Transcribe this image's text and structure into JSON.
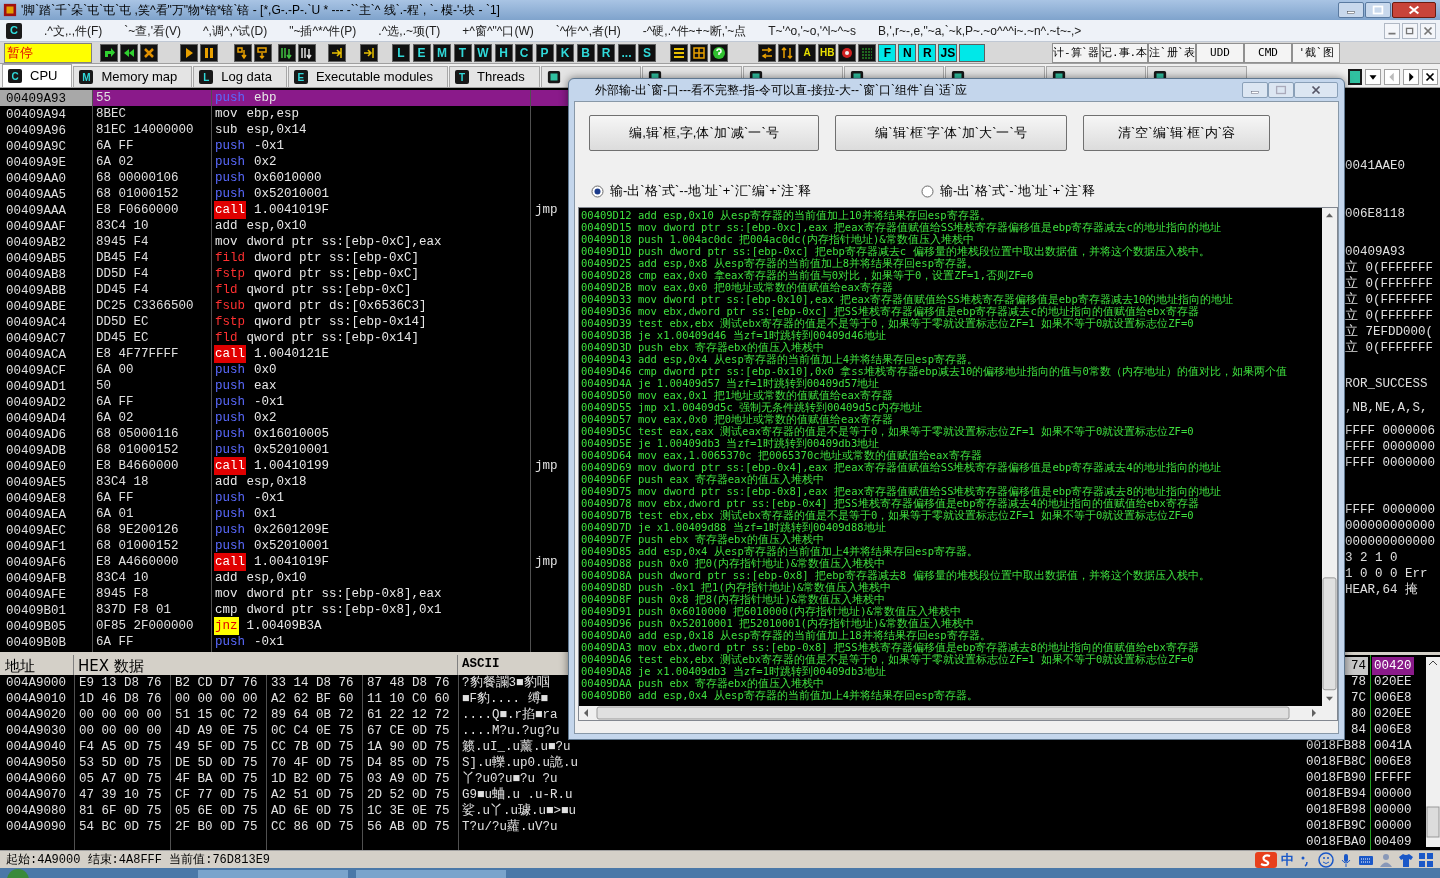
{
  "window": {
    "title": "'脚`踏`千`朵`屯`屯`屯 ,笑^看\"万\"物*锫*锫`锫 - [*,G-.-P-.`U *  ---  -``主`^ 线`.-程`, `- 模-'-块  - `1]"
  },
  "menu": [
    ".^文,.,件(F)",
    "`~查,'看(V)",
    "^,调^,^试(D)",
    "\"~插^*^件(P)",
    ".^选,.~项(T)",
    "+^窗^\"^口(W)",
    "`^作^^,者(H)",
    "-^硬,.^件~+~断,'~点",
    "T~'^o,'~o,'^l~^~s",
    "B,',r~-,e,\"~a,`~k,P~.~o^^^i~.~n^.~t~-,>"
  ],
  "menu_badge": "C",
  "toolbar": {
    "status": "暂停",
    "view_buttons": [
      "L",
      "E",
      "M",
      "T",
      "W",
      "H",
      "C",
      "P",
      "K",
      "B",
      "R",
      "...",
      "S"
    ],
    "plugin_buttons": [
      "A",
      "HB"
    ],
    "script_buttons": [
      "F",
      "N",
      "R",
      "JS"
    ],
    "tools": [
      "计-算`器",
      "记.事.本",
      "注`册`表",
      "UDD",
      "CMD",
      "'截`图"
    ]
  },
  "tabs": [
    {
      "badge": "C",
      "label": "CPU",
      "selected": true
    },
    {
      "badge": "M",
      "label": "Memory map",
      "selected": false
    },
    {
      "badge": "L",
      "label": "Log data",
      "selected": false
    },
    {
      "badge": "E",
      "label": "Executable modules",
      "selected": false
    },
    {
      "badge": "T",
      "label": "Threads",
      "selected": false
    },
    {
      "selected": false
    },
    {
      "selected": false
    },
    {
      "selected": false
    },
    {
      "selected": false
    },
    {
      "selected": false
    },
    {
      "selected": false
    },
    {
      "selected": false
    }
  ],
  "disassembly": [
    {
      "address": "00409A93",
      "hex": "55",
      "op": "push",
      "args": "ebp",
      "kind": "push",
      "selected": true
    },
    {
      "address": "00409A94",
      "hex": "8BEC",
      "op": "mov",
      "args": "ebp,esp",
      "kind": "plain",
      "selected": false
    },
    {
      "address": "00409A96",
      "hex": "81EC 14000000",
      "op": "sub",
      "args": "esp,0x14",
      "kind": "plain",
      "selected": false
    },
    {
      "address": "00409A9C",
      "hex": "6A FF",
      "op": "push",
      "args": "-0x1",
      "kind": "push",
      "selected": false
    },
    {
      "address": "00409A9E",
      "hex": "6A 02",
      "op": "push",
      "args": "0x2",
      "kind": "push",
      "selected": false
    },
    {
      "address": "00409AA0",
      "hex": "68 00000106",
      "op": "push",
      "args": "0x6010000",
      "kind": "push",
      "selected": false
    },
    {
      "address": "00409AA5",
      "hex": "68 01000152",
      "op": "push",
      "args": "0x52010001",
      "kind": "push",
      "selected": false
    },
    {
      "address": "00409AAA",
      "hex": "E8 F0660000",
      "op": "call",
      "args": "1.0041019F",
      "kind": "call",
      "selected": false,
      "comment": "jmp"
    },
    {
      "address": "00409AAF",
      "hex": "83C4 10",
      "op": "add",
      "args": "esp,0x10",
      "kind": "plain",
      "selected": false
    },
    {
      "address": "00409AB2",
      "hex": "8945 F4",
      "op": "mov",
      "args": "dword ptr ss:[ebp-0xC],eax",
      "kind": "plain",
      "selected": false
    },
    {
      "address": "00409AB5",
      "hex": "DB45 F4",
      "op": "fild",
      "args": "dword ptr ss:[ebp-0xC]",
      "kind": "fpu",
      "selected": false
    },
    {
      "address": "00409AB8",
      "hex": "DD5D F4",
      "op": "fstp",
      "args": "qword ptr ss:[ebp-0xC]",
      "kind": "fpu",
      "selected": false
    },
    {
      "address": "00409ABB",
      "hex": "DD45 F4",
      "op": "fld",
      "args": "qword ptr ss:[ebp-0xC]",
      "kind": "fpu",
      "selected": false
    },
    {
      "address": "00409ABE",
      "hex": "DC25 C3366500",
      "op": "fsub",
      "args": "qword ptr ds:[0x6536C3]",
      "kind": "fpu",
      "selected": false
    },
    {
      "address": "00409AC4",
      "hex": "DD5D EC",
      "op": "fstp",
      "args": "qword ptr ss:[ebp-0x14]",
      "kind": "fpu",
      "selected": false
    },
    {
      "address": "00409AC7",
      "hex": "DD45 EC",
      "op": "fld",
      "args": "qword ptr ss:[ebp-0x14]",
      "kind": "fpu",
      "selected": false
    },
    {
      "address": "00409ACA",
      "hex": "E8 4F77FFFF",
      "op": "call",
      "args": "1.0040121E",
      "kind": "call",
      "selected": false
    },
    {
      "address": "00409ACF",
      "hex": "6A 00",
      "op": "push",
      "args": "0x0",
      "kind": "push",
      "selected": false
    },
    {
      "address": "00409AD1",
      "hex": "50",
      "op": "push",
      "args": "eax",
      "kind": "push",
      "selected": false
    },
    {
      "address": "00409AD2",
      "hex": "6A FF",
      "op": "push",
      "args": "-0x1",
      "kind": "push",
      "selected": false
    },
    {
      "address": "00409AD4",
      "hex": "6A 02",
      "op": "push",
      "args": "0x2",
      "kind": "push",
      "selected": false
    },
    {
      "address": "00409AD6",
      "hex": "68 05000116",
      "op": "push",
      "args": "0x16010005",
      "kind": "push",
      "selected": false
    },
    {
      "address": "00409ADB",
      "hex": "68 01000152",
      "op": "push",
      "args": "0x52010001",
      "kind": "push",
      "selected": false
    },
    {
      "address": "00409AE0",
      "hex": "E8 B4660000",
      "op": "call",
      "args": "1.00410199",
      "kind": "call",
      "selected": false,
      "comment": "jmp"
    },
    {
      "address": "00409AE5",
      "hex": "83C4 18",
      "op": "add",
      "args": "esp,0x18",
      "kind": "plain",
      "selected": false
    },
    {
      "address": "00409AE8",
      "hex": "6A FF",
      "op": "push",
      "args": "-0x1",
      "kind": "push",
      "selected": false
    },
    {
      "address": "00409AEA",
      "hex": "6A 01",
      "op": "push",
      "args": "0x1",
      "kind": "push",
      "selected": false
    },
    {
      "address": "00409AEC",
      "hex": "68 9E200126",
      "op": "push",
      "args": "0x2601209E",
      "kind": "push",
      "selected": false
    },
    {
      "address": "00409AF1",
      "hex": "68 01000152",
      "op": "push",
      "args": "0x52010001",
      "kind": "push",
      "selected": false
    },
    {
      "address": "00409AF6",
      "hex": "E8 A4660000",
      "op": "call",
      "args": "1.0041019F",
      "kind": "call",
      "selected": false,
      "comment": "jmp"
    },
    {
      "address": "00409AFB",
      "hex": "83C4 10",
      "op": "add",
      "args": "esp,0x10",
      "kind": "plain",
      "selected": false
    },
    {
      "address": "00409AFE",
      "hex": "8945 F8",
      "op": "mov",
      "args": "dword ptr ss:[ebp-0x8],eax",
      "kind": "plain",
      "selected": false
    },
    {
      "address": "00409B01",
      "hex": "837D F8 01",
      "op": "cmp",
      "args": "dword ptr ss:[ebp-0x8],0x1",
      "kind": "plain",
      "selected": false
    },
    {
      "address": "00409B05",
      "hex": "0F85 2F000000",
      "op": "jnz",
      "args": "1.00409B3A",
      "kind": "jcc",
      "selected": false
    },
    {
      "address": "00409B0B",
      "hex": "6A FF",
      "op": "push",
      "args": "-0x1",
      "kind": "push",
      "selected": false
    }
  ],
  "registers": [
    [
      "0041AAE0"
    ],
    [
      "006E8118"
    ],
    [
      "00409A93",
      "立 0(FFFFFFF",
      "立 0(FFFFFFF",
      "立 0(FFFFFFF",
      "立 0(FFFFFFF",
      "立 7EFDD000(",
      "立 0(FFFFFFF"
    ],
    [
      "ROR_SUCCESS"
    ],
    [
      ",NB,NE,A,S,"
    ],
    [
      "FFFF 0000006",
      "FFFF 0000000",
      "FFFF 0000000"
    ],
    [
      "FFFF 0000000",
      "000000000000",
      "000000000000",
      "3 2 1 0",
      "1 0 0 0 Err",
      "HEAR,64 掩"
    ]
  ],
  "dialog": {
    "title": "外部输-出`窗-口---看不完整-指-令可以直-接拉-大--`窗`口`组件`自`适`应",
    "buttons": [
      "编,辑`框,字,体`加`减`一`号",
      "编`辑`框`字`体`加`大`一`号",
      "清`空`编`辑`框`内`容"
    ],
    "radios": [
      {
        "label": "输-出`格`式`--地`址`+`汇`编`+`注`释",
        "selected": true
      },
      {
        "label": "输-出`格`式`-`地`址`+`注`释",
        "selected": false
      }
    ],
    "output_lines": [
      "00409D12 add esp,0x10 从esp寄存器的当前值加上10并将结果存回esp寄存器。",
      "00409D15 mov dword ptr ss:[ebp-0xc],eax 把eax寄存器值赋值给SS堆栈寄存器偏移值是ebp寄存器减去c的地址指向的地址",
      "00409D18 push 1.004ac0dc 把004ac0dc(内存指针地址)&常数值压入堆栈中",
      "00409D1D push dword ptr ss:[ebp-0xc] 把ebp寄存器减去c 偏移量的堆栈段位置中取出数据值，并将这个数据压入栈中。",
      "00409D25 add esp,0x8 从esp寄存器的当前值加上8并将结果存回esp寄存器。",
      "00409D28 cmp eax,0x0 拿eax寄存器的当前值与0对比，如果等于0，设置ZF=1,否则ZF=0",
      "00409D2B mov eax,0x0 把0地址或常数的值赋值给eax寄存器",
      "00409D33 mov dword ptr ss:[ebp-0x10],eax 把eax寄存器值赋值给SS堆栈寄存器偏移值是ebp寄存器减去10的地址指向的地址",
      "00409D36 mov ebx,dword ptr ss:[ebp-0xc] 把SS堆栈寄存器偏移值是ebp寄存器减去c的地址指向的值赋值给ebx寄存器",
      "00409D39 test ebx,ebx 测试ebx寄存器的值是不是等于0，如果等于零就设置标志位ZF=1 如果不等于0就设置标志位ZF=0",
      "00409D3B je x1.00409d46 当zf=1时跳转到00409d46地址",
      "00409D3D push ebx 寄存器ebx的值压入堆栈中",
      "00409D43 add esp,0x4 从esp寄存器的当前值加上4并将结果存回esp寄存器。",
      "00409D46 cmp dword ptr ss:[ebp-0x10],0x0 拿ss堆栈寄存器ebp减去10的偏移地址指向的值与0常数（内存地址）的值对比，如果两个值",
      "00409D4A je 1.00409d57 当zf=1时跳转到00409d57地址",
      "00409D50 mov eax,0x1 把1地址或常数的值赋值给eax寄存器",
      "00409D55 jmp x1.00409d5c 强制无条件跳转到00409d5c内存地址",
      "00409D57 mov eax,0x0 把0地址或常数的值赋值给eax寄存器",
      "00409D5C test eax,eax 测试eax寄存器的值是不是等于0，如果等于零就设置标志位ZF=1 如果不等于0就设置标志位ZF=0",
      "00409D5E je 1.00409db3 当zf=1时跳转到00409db3地址",
      "00409D64 mov eax,1.0065370c 把0065370c地址或常数的值赋值给eax寄存器",
      "00409D69 mov dword ptr ss:[ebp-0x4],eax 把eax寄存器值赋值给SS堆栈寄存器偏移值是ebp寄存器减去4的地址指向的地址",
      "00409D6F push eax 寄存器eax的值压入堆栈中",
      "00409D75 mov dword ptr ss:[ebp-0x8],eax 把eax寄存器值赋值给SS堆栈寄存器偏移值是ebp寄存器减去8的地址指向的地址",
      "00409D78 mov ebx,dword ptr ss:[ebp-0x4] 把SS堆栈寄存器偏移值是ebp寄存器减去4的地址指向的值赋值给ebx寄存器",
      "00409D7B test ebx,ebx 测试ebx寄存器的值是不是等于0，如果等于零就设置标志位ZF=1 如果不等于0就设置标志位ZF=0",
      "00409D7D je x1.00409d88 当zf=1时跳转到00409d88地址",
      "00409D7F push ebx 寄存器ebx的值压入堆栈中",
      "00409D85 add esp,0x4 从esp寄存器的当前值加上4并将结果存回esp寄存器。",
      "00409D88 push 0x0 把0(内存指针地址)&常数值压入堆栈中",
      "00409D8A push dword ptr ss:[ebp-0x8] 把ebp寄存器减去8 偏移量的堆栈段位置中取出数据值，并将这个数据压入栈中。",
      "00409D8D push -0x1 把1(内存指针地址)&常数值压入堆栈中",
      "00409D8F push 0x8 把8(内存指针地址)&常数值压入堆栈中",
      "00409D91 push 0x6010000 把6010000(内存指针地址)&常数值压入堆栈中",
      "00409D96 push 0x52010001 把52010001(内存指针地址)&常数值压入堆栈中",
      "00409DA0 add esp,0x18 从esp寄存器的当前值加上18并将结果存回esp寄存器。",
      "00409DA3 mov ebx,dword ptr ss:[ebp-0x8] 把SS堆栈寄存器偏移值是ebp寄存器减去8的地址指向的值赋值给ebx寄存器",
      "00409DA6 test ebx,ebx 测试ebx寄存器的值是不是等于0，如果等于零就设置标志位ZF=1 如果不等于0就设置标志位ZF=0",
      "00409DA8 je x1.00409db3 当zf=1时跳转到00409db3地址",
      "00409DAA push ebx 寄存器ebx的值压入堆栈中",
      "00409DB0 add esp,0x4 从esp寄存器的当前值加上4并将结果存回esp寄存器。"
    ]
  },
  "dump": {
    "columns": [
      "地址",
      "HEX 数据",
      "ASCII"
    ],
    "rows": [
      {
        "address": "004A9000",
        "hex": [
          "E9 13 D8 76",
          "B2 CD D7 76",
          "33 14 D8 76",
          "87 48 D8 76"
        ],
        "ascii": "?豹餐讕3■豹啯"
      },
      {
        "address": "004A9010",
        "hex": [
          "1D 46 D8 76",
          "00 00 00 00",
          "A2 62 BF 60",
          "11 10 C0 60"
        ],
        "ascii": "■F豹....  缚■"
      },
      {
        "address": "004A9020",
        "hex": [
          "00 00 00 00",
          "51 15 0C 72",
          "89 64 0B 72",
          "61 22 12 72"
        ],
        "ascii": "....Q■.r掐■ra"
      },
      {
        "address": "004A9030",
        "hex": [
          "00 00 00 00",
          "4D A9 0E 75",
          "0C C4 0E 75",
          "67 CE 0D 75"
        ],
        "ascii": "....M?u.?ug?u"
      },
      {
        "address": "004A9040",
        "hex": [
          "F4 A5 0D 75",
          "49 5F 0D 75",
          "CC 7B 0D 75",
          "1A 90 0D 75"
        ],
        "ascii": "籁.uI_.u薰.u■?u"
      },
      {
        "address": "004A9050",
        "hex": [
          "53 5D 0D 75",
          "DE 5D 0D 75",
          "70 4F 0D 75",
          "D4 85 0D 75"
        ],
        "ascii": "S].u轢.up0.u詭.u"
      },
      {
        "address": "004A9060",
        "hex": [
          "05 A7 0D 75",
          "4F BA 0D 75",
          "1D B2 0D 75",
          "03 A9 0D 75"
        ],
        "ascii": "丫?u0?u■?u ?u"
      },
      {
        "address": "004A9070",
        "hex": [
          "47 39 10 75",
          "CF 77 0D 75",
          "A2 51 0D 75",
          "2D 52 0D 75"
        ],
        "ascii": "G9■u蛐.u  .u-R.u"
      },
      {
        "address": "004A9080",
        "hex": [
          "81 6F 0D 75",
          "05 6E 0D 75",
          "AD 6E 0D 75",
          "1C 3E 0E 75"
        ],
        "ascii": "娑.u丫.u璩.u■>■u"
      },
      {
        "address": "004A9090",
        "hex": [
          "54 BC 0D 75",
          "2F B0 0D 75",
          "CC 86 0D 75",
          "56 AB 0D 75"
        ],
        "ascii": "T?u/?u蘿.uV?u"
      }
    ]
  },
  "stack": [
    {
      "address": "74",
      "value": "00420",
      "selected": true
    },
    {
      "address": "78",
      "value": "020EE",
      "selected": false
    },
    {
      "address": "7C",
      "value": "006E8",
      "selected": false
    },
    {
      "address": "80",
      "value": "020EE",
      "selected": false
    },
    {
      "address": "84",
      "value": "006E8",
      "selected": false
    },
    {
      "address": "0018FB88",
      "value": "0041A",
      "selected": false
    },
    {
      "address": "0018FB8C",
      "value": "006E8",
      "selected": false
    },
    {
      "address": "0018FB90",
      "value": "FFFFF",
      "selected": false
    },
    {
      "address": "0018FB94",
      "value": "00000",
      "selected": false
    },
    {
      "address": "0018FB98",
      "value": "00000",
      "selected": false
    },
    {
      "address": "0018FB9C",
      "value": "00000",
      "selected": false
    },
    {
      "address": "0018FBA0",
      "value": "00409",
      "selected": false
    }
  ],
  "status_bar": "起始:4A9000 结束:4A8FFF 当前值:76D813E9",
  "ime": {
    "label": "中"
  }
}
